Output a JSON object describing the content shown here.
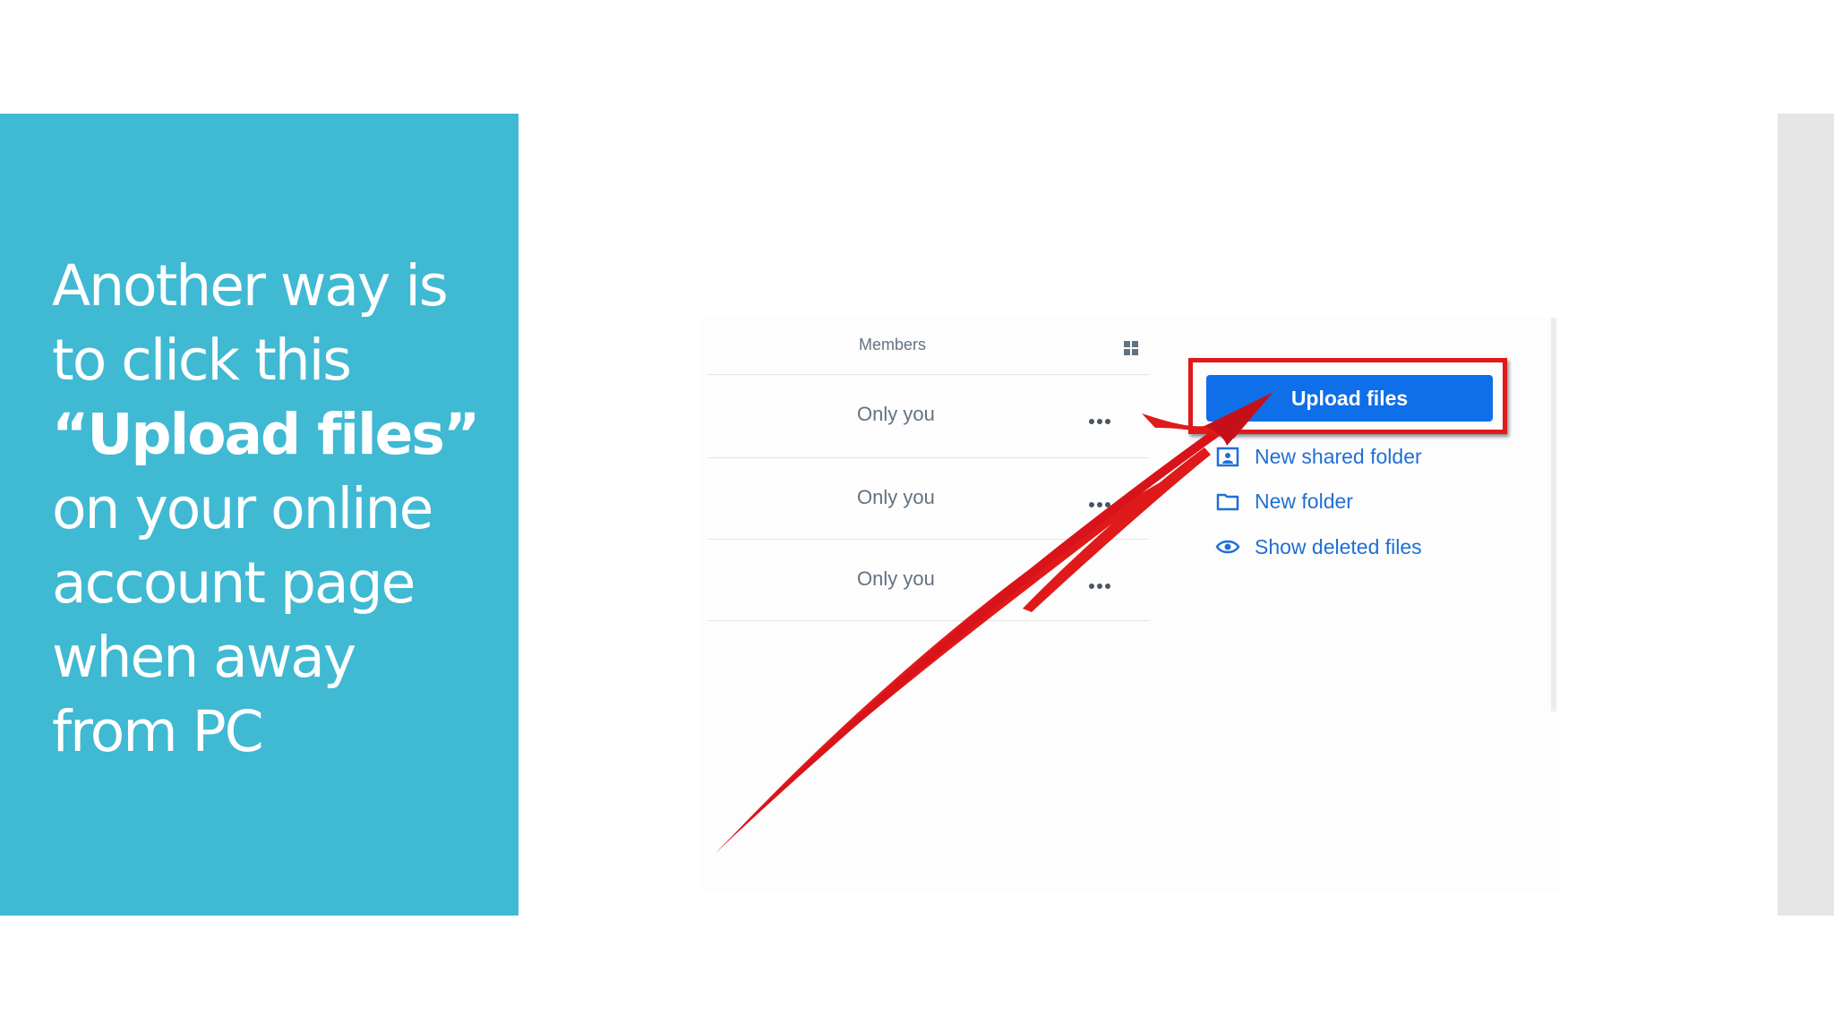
{
  "slide": {
    "text_lines": [
      "Another way is",
      "to click this",
      "“Upload files”",
      "on your online",
      "account page",
      "when away",
      "from PC"
    ]
  },
  "colors": {
    "panel": "#40b9d3",
    "button": "#0f6fe8",
    "highlight": "#e01a1a",
    "link": "#1f6fd6"
  },
  "file_list": {
    "column_header": "Members",
    "view_toggle_icon": "grid-icon",
    "rows": [
      {
        "members": "Only you",
        "more_icon": "more-dots-icon"
      },
      {
        "members": "Only you",
        "more_icon": "more-dots-icon"
      },
      {
        "members": "Only you",
        "more_icon": "more-dots-icon"
      }
    ]
  },
  "actions": {
    "upload_label": "Upload files",
    "items": [
      {
        "label": "New shared folder",
        "icon": "shared-folder-icon"
      },
      {
        "label": "New folder",
        "icon": "folder-icon"
      },
      {
        "label": "Show deleted files",
        "icon": "eye-icon"
      }
    ]
  },
  "annotation": {
    "arrow_icon": "red-arrow-icon",
    "highlight_box": "red-highlight-box"
  }
}
